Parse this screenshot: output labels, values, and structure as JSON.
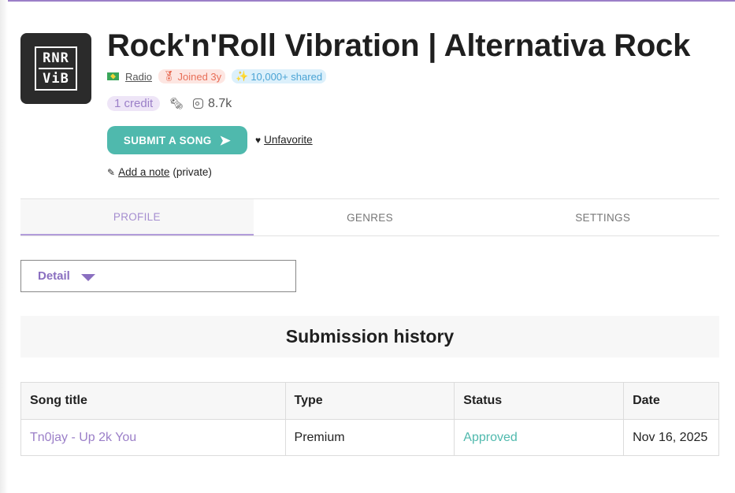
{
  "profile": {
    "logo_line1": "RNR",
    "logo_line2": "ViB",
    "title": "Rock'n'Roll Vibration | Alternativa Rock",
    "type_label": "Radio",
    "joined_badge": "Joined 3y",
    "shared_badge": "10,000+ shared",
    "credit": "1 credit",
    "followers": "8.7k"
  },
  "actions": {
    "submit_label": "SUBMIT A SONG",
    "unfavorite_label": "Unfavorite",
    "add_note_label": "Add a note",
    "private_label": "(private)"
  },
  "tabs": [
    {
      "label": "PROFILE",
      "active": true
    },
    {
      "label": "GENRES",
      "active": false
    },
    {
      "label": "SETTINGS",
      "active": false
    }
  ],
  "detail_select": {
    "label": "Detail"
  },
  "history": {
    "title": "Submission history",
    "columns": [
      "Song title",
      "Type",
      "Status",
      "Date"
    ],
    "rows": [
      {
        "song": "Tn0jay - Up 2k You",
        "type": "Premium",
        "status": "Approved",
        "date": "Nov 16, 2025"
      }
    ]
  },
  "colors": {
    "accent_purple": "#9b7fc8",
    "accent_teal": "#4fb9ad"
  }
}
